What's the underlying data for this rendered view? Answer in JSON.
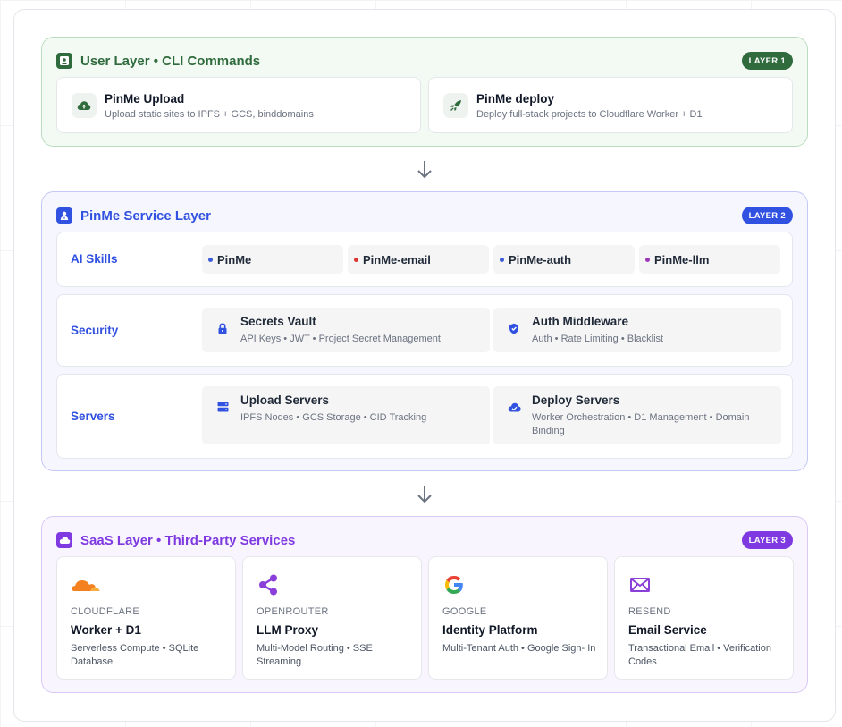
{
  "layer1": {
    "title": "User Layer • CLI Commands",
    "badge": "LAYER 1",
    "cards": [
      {
        "icon": "cloud-upload-icon",
        "title": "PinMe Upload",
        "subtitle": "Upload static sites to IPFS + GCS, binddomains"
      },
      {
        "icon": "rocket-icon",
        "title": "PinMe deploy",
        "subtitle": "Deploy full-stack projects to Cloudflare Worker + D1"
      }
    ]
  },
  "layer2": {
    "title": "PinMe Service Layer",
    "badge": "LAYER 2",
    "ai_skills": {
      "label": "AI Skills",
      "chips": [
        {
          "name": "PinMe",
          "dot_color": "#3b5bdb"
        },
        {
          "name": "PinMe-email",
          "dot_color": "#e03131"
        },
        {
          "name": "PinMe-auth",
          "dot_color": "#3b5bdb"
        },
        {
          "name": "PinMe-llm",
          "dot_color": "#9c36b5"
        }
      ]
    },
    "security": {
      "label": "Security",
      "cards": [
        {
          "icon": "lock-icon",
          "title": "Secrets Vault",
          "subtitle": "API Keys • JWT • Project Secret Management"
        },
        {
          "icon": "shield-icon",
          "title": "Auth Middleware",
          "subtitle": "Auth • Rate Limiting • Blacklist"
        }
      ]
    },
    "servers": {
      "label": "Servers",
      "cards": [
        {
          "icon": "server-icon",
          "title": "Upload Servers",
          "subtitle": "IPFS Nodes • GCS Storage • CID Tracking"
        },
        {
          "icon": "cloud-check-icon",
          "title": "Deploy Servers",
          "subtitle": "Worker Orchestration • D1 Management • Domain Binding"
        }
      ]
    }
  },
  "layer3": {
    "title": "SaaS Layer • Third-Party Services",
    "badge": "LAYER 3",
    "cards": [
      {
        "logo": "cloudflare-logo",
        "vendor": "CLOUDFLARE",
        "title": "Worker + D1",
        "subtitle": "Serverless Compute • SQLite Database"
      },
      {
        "logo": "openrouter-share-icon",
        "vendor": "OPENROUTER",
        "title": "LLM Proxy",
        "subtitle": "Multi-Model Routing • SSE Streaming"
      },
      {
        "logo": "google-logo",
        "vendor": "GOOGLE",
        "title": "Identity Platform",
        "subtitle": "Multi-Tenant Auth • Google Sign- In"
      },
      {
        "logo": "mail-icon",
        "vendor": "RESEND",
        "title": "Email Service",
        "subtitle": "Transactional Email • Verification Codes"
      }
    ]
  },
  "colors": {
    "layer1_accent": "#2f6b3c",
    "layer2_accent": "#3151e0",
    "layer3_accent": "#7e3ae0"
  }
}
